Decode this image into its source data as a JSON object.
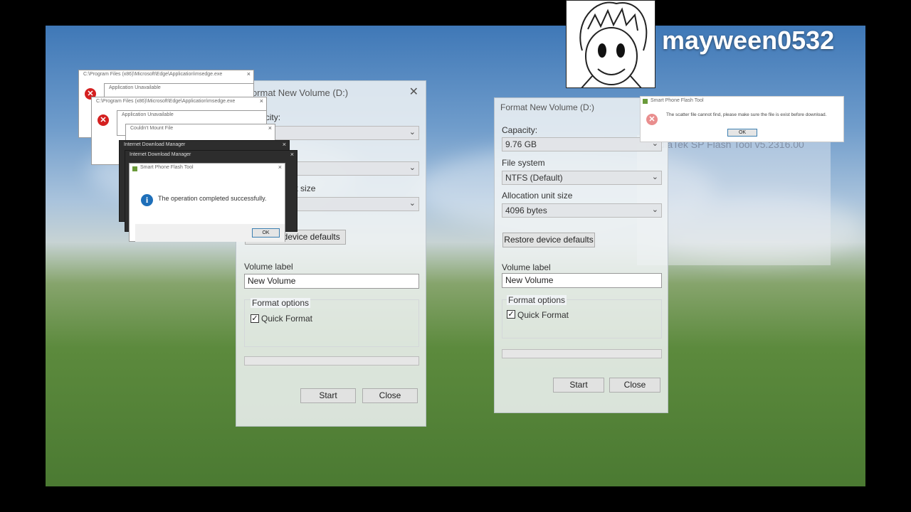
{
  "channel_name": "mayween0532",
  "format_left": {
    "title": "Format New Volume (D:)",
    "capacity_label": "Capacity:",
    "capacity_value": "",
    "filesystem_value": "",
    "alloc_label": "Allocation unit size",
    "alloc_value": "",
    "restore_label": "Restore device defaults",
    "volume_label_label": "Volume label",
    "volume_label_value": "New Volume",
    "format_options_label": "Format options",
    "quick_format_label": "Quick Format",
    "quick_format_checked": true,
    "start_label": "Start",
    "close_label": "Close"
  },
  "format_right": {
    "title": "Format New Volume (D:)",
    "capacity_label": "Capacity:",
    "capacity_value": "9.76 GB",
    "filesystem_label": "File system",
    "filesystem_value": "NTFS (Default)",
    "alloc_label": "Allocation unit size",
    "alloc_value": "4096 bytes",
    "restore_label": "Restore device defaults",
    "volume_label_label": "Volume label",
    "volume_label_value": "New Volume",
    "format_options_label": "Format options",
    "quick_format_label": "Quick Format",
    "quick_format_checked": true,
    "start_label": "Start",
    "close_label": "Close"
  },
  "error_windows": [
    {
      "title": "C:\\Program Files (x86)\\Microsoft\\Edge\\Application\\msedge.exe"
    },
    {
      "title": "Application Unavailable"
    },
    {
      "title": "C:\\Program Files (x86)\\Microsoft\\Edge\\Application\\msedge.exe"
    },
    {
      "title": "Application Unavailable"
    },
    {
      "title": "Couldn't Mount File"
    }
  ],
  "idm_windows": [
    {
      "title": "Internet Download Manager"
    },
    {
      "title": "Internet Download Manager"
    }
  ],
  "success_dialog": {
    "title": "Smart Phone Flash Tool",
    "message": "The operation completed successfully.",
    "ok_label": "OK"
  },
  "scatter_dialog": {
    "title": "Smart Phone Flash Tool",
    "message": "The scatter file cannot find, please make sure the file is exist before download.",
    "ok_label": "OK"
  },
  "flash_tool_bg": {
    "title": "MediaTek SP Flash Tool v5.2316.00"
  },
  "icons": {
    "close": "close-icon",
    "dropdown": "chevron-down-icon",
    "error": "error-icon",
    "info": "info-icon",
    "check": "checkmark-icon"
  }
}
